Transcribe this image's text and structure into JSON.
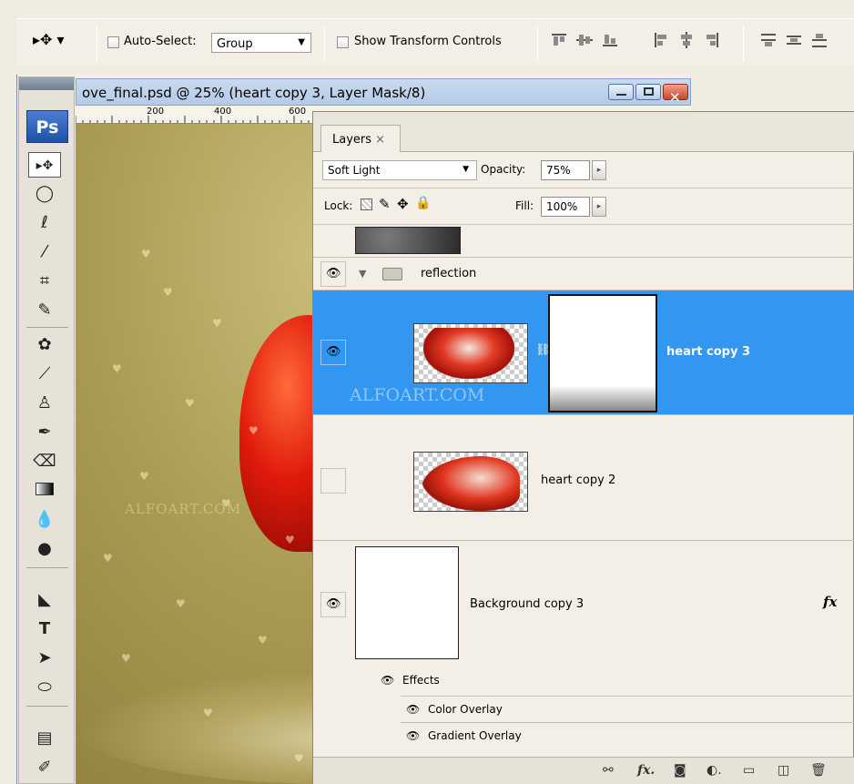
{
  "options_bar": {
    "auto_select_label": "Auto-Select:",
    "auto_select_value": "Group",
    "show_transform_label": "Show Transform Controls"
  },
  "document": {
    "title": "ove_final.psd @ 25% (heart copy 3, Layer Mask/8)",
    "ruler_ticks": [
      "200",
      "400",
      "600"
    ],
    "watermark": "ALFOART.COM"
  },
  "toolbox": {
    "logo": "Ps"
  },
  "layers_panel": {
    "tab_label": "Layers",
    "tab_close": "×",
    "blend_mode": "Soft Light",
    "opacity_label": "Opacity:",
    "opacity_value": "75%",
    "lock_label": "Lock:",
    "fill_label": "Fill:",
    "fill_value": "100%",
    "group_name": "reflection",
    "layers": [
      {
        "name": "heart copy 3",
        "selected": true,
        "visible": true
      },
      {
        "name": "heart copy 2",
        "selected": false,
        "visible": false
      },
      {
        "name": "Background copy 3",
        "selected": false,
        "visible": true
      }
    ],
    "fx_label": "fx",
    "effects_label": "Effects",
    "effect_items": [
      "Color Overlay",
      "Gradient Overlay"
    ],
    "watermark": "ALFOART.COM"
  },
  "colors": {
    "selected_row": "#3396f0",
    "canvas": "#a99b52"
  }
}
